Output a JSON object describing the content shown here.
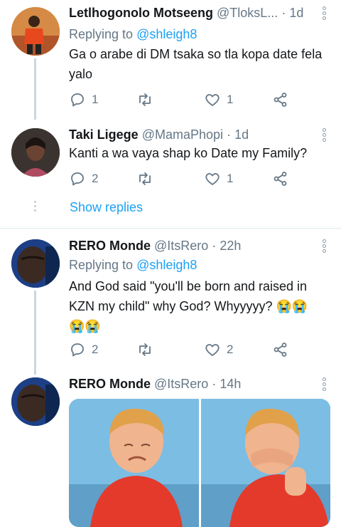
{
  "tweets": [
    {
      "name": "Letlhogonolo Motseeng",
      "handle": "@TloksL...",
      "time": "1d",
      "replying_label": "Replying to",
      "replying_handle": "@shleigh8",
      "text": "Ga o arabe di DM tsaka so tla kopa date fela yalo",
      "reply_count": "1",
      "retweet_count": "",
      "like_count": "1"
    },
    {
      "name": "Taki Ligege",
      "handle": "@MamaPhopi",
      "time": "1d",
      "text": "Kanti a wa vaya shap ko Date my Family?",
      "reply_count": "2",
      "retweet_count": "",
      "like_count": "1"
    },
    {
      "name": "RERO Monde",
      "handle": "@ItsRero",
      "time": "22h",
      "replying_label": "Replying to",
      "replying_handle": "@shleigh8",
      "text": "And God said \"you'll be born and raised in KZN my child\" why God? Whyyyyy? 😭😭 😭😭",
      "reply_count": "2",
      "retweet_count": "",
      "like_count": "2"
    },
    {
      "name": "RERO Monde",
      "handle": "@ItsRero",
      "time": "14h"
    }
  ],
  "show_replies": "Show replies",
  "icons": {
    "reply": "reply-icon",
    "retweet": "retweet-icon",
    "like": "heart-icon",
    "share": "share-icon",
    "menu": "more-vertical-icon"
  },
  "colors": {
    "link": "#1da1f2",
    "muted": "#657786",
    "thread": "#ccd6dd"
  }
}
